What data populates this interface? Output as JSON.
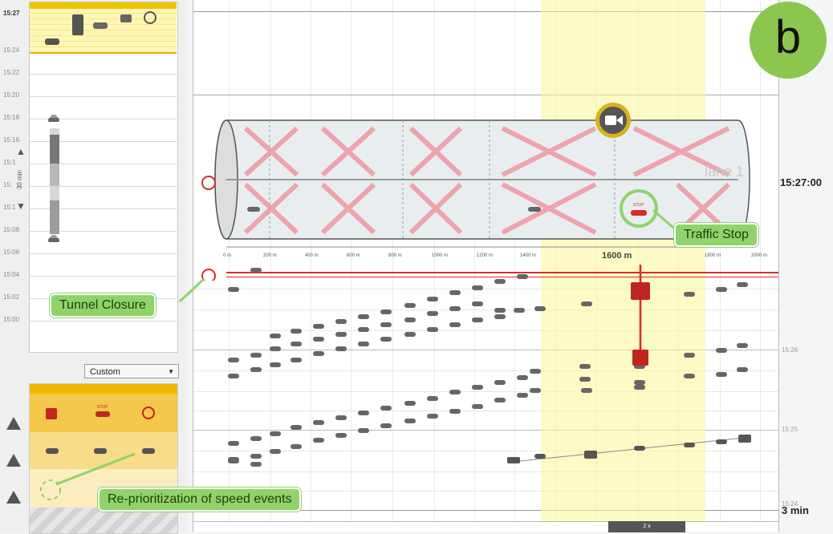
{
  "timeline": {
    "current_time": "15:27",
    "ticks": [
      "15:24",
      "15:22",
      "15:20",
      "15:18",
      "15:16",
      "15:1",
      "15:",
      "15:1",
      "15:08",
      "15:06",
      "15:04",
      "15:02",
      "15:00"
    ],
    "window_label": "30 min"
  },
  "priority": {
    "preset_select": "Custom",
    "stop_label": "STOP"
  },
  "main": {
    "badge": "b",
    "lane_label": "lane 1",
    "distance_marker": "1600 m",
    "tick_labels": [
      "0 m",
      "200 m",
      "400 m",
      "600 m",
      "800 m",
      "1000 m",
      "1200 m",
      "1400 m",
      "1800 m",
      "2000 m"
    ],
    "right_time": "15:27:00",
    "right_ticks": [
      "15:26",
      "15:25",
      "15:24"
    ],
    "window_min": "3 min",
    "playback_speed": "2 x",
    "stop_label": "STOP"
  },
  "callouts": {
    "traffic_stop": "Traffic Stop",
    "tunnel_closure": "Tunnel Closure",
    "reprioritization": "Re-prioritization of speed events"
  },
  "colors": {
    "highlight_yellow": "#f8e97a",
    "accent_red": "#d42c2c",
    "callout_green": "#8fd36a",
    "badge_green": "#8bc74e"
  },
  "icons": [
    "camera-icon",
    "stop-sign-car-icon",
    "tunnel-closure-icon",
    "broken-car-icon",
    "truck-icon",
    "speed-car-icon",
    "slow-car-icon"
  ]
}
